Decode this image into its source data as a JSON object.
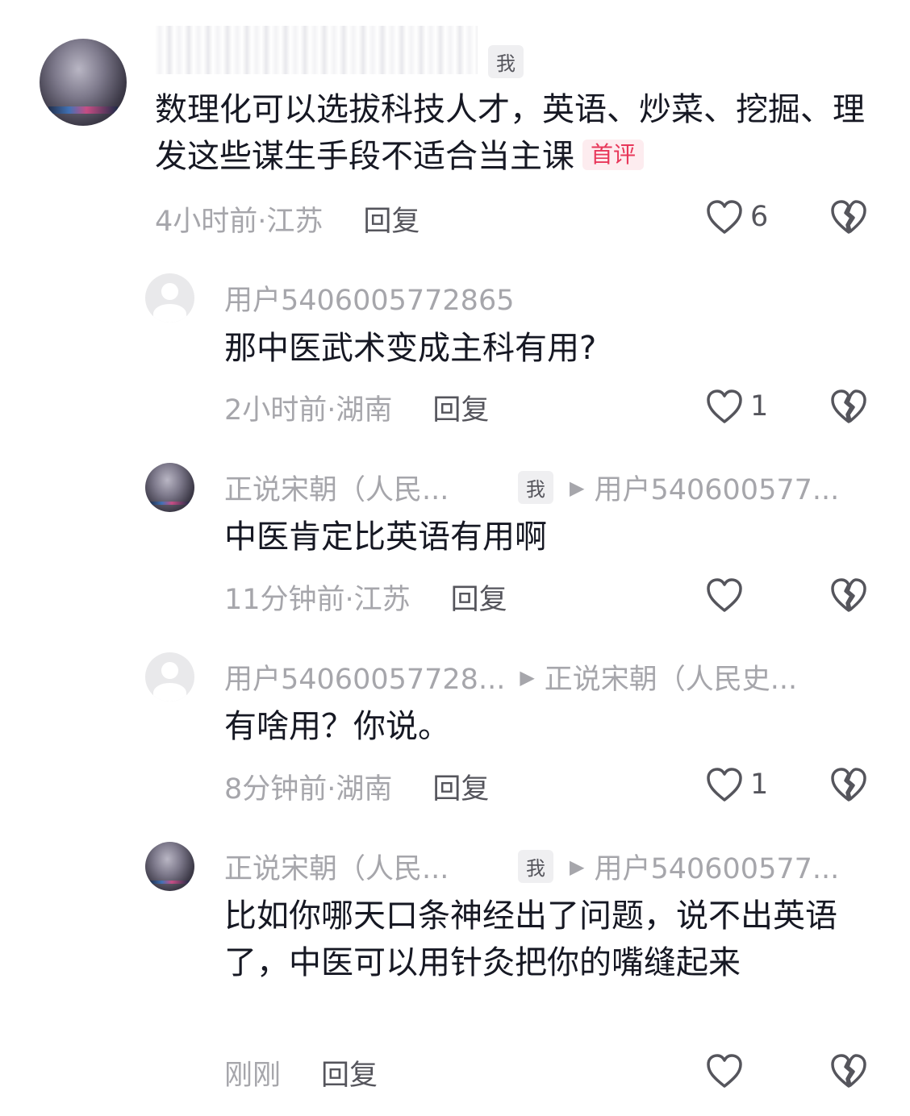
{
  "comments": [
    {
      "username": "",
      "me_badge": "我",
      "text": "数理化可以选拔科技人才，英语、炒菜、挖掘、理发这些谋生手段不适合当主课",
      "first_badge": "首评",
      "time": "4小时前·江苏",
      "reply": "回复",
      "likes": "6",
      "avatar": "photo"
    },
    {
      "username": "用户5406005772865",
      "text": "那中医武术变成主科有用?",
      "time": "2小时前·湖南",
      "reply": "回复",
      "likes": "1",
      "avatar": "default"
    },
    {
      "username": "正说宋朝（人民...",
      "me_badge": "我",
      "reply_to": "用户540600577...",
      "text": "中医肯定比英语有用啊",
      "time": "11分钟前·江苏",
      "reply": "回复",
      "likes": "",
      "avatar": "photo"
    },
    {
      "username": "用户54060057728...",
      "reply_to": "正说宋朝（人民史...",
      "text": "有啥用？你说。",
      "time": "8分钟前·湖南",
      "reply": "回复",
      "likes": "1",
      "avatar": "default"
    },
    {
      "username": "正说宋朝（人民...",
      "me_badge": "我",
      "reply_to": "用户540600577...",
      "text": "比如你哪天口条神经出了问题，说不出英语了，中医可以用针灸把你的嘴缝起来",
      "time": "刚刚",
      "reply": "回复",
      "likes": "",
      "avatar": "photo"
    }
  ],
  "colors": {
    "text": "#161823",
    "muted": "#a6a6ab",
    "reply": "#55555c",
    "first_badge": "#e8375a"
  },
  "icons": [
    "heart-icon",
    "broken-heart-icon",
    "play-arrow-icon"
  ]
}
